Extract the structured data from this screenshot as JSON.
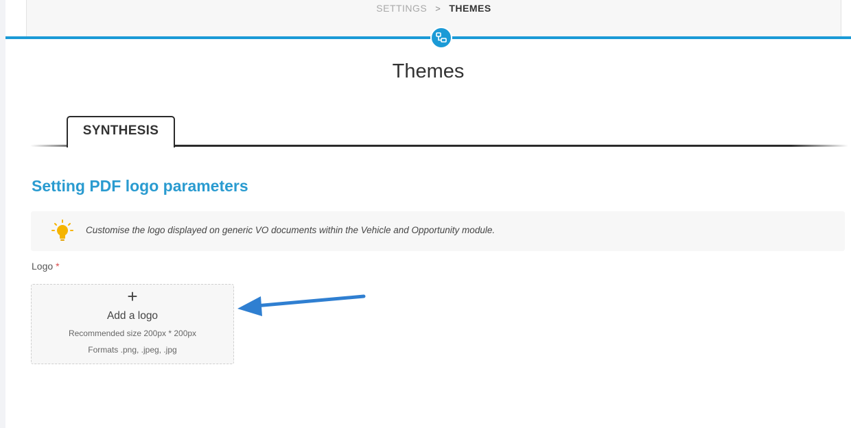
{
  "breadcrumb": {
    "parent": "SETTINGS",
    "separator": ">",
    "current": "THEMES"
  },
  "header": {
    "icon": "network-icon",
    "accent_color": "#1b9ad6"
  },
  "page": {
    "title": "Themes"
  },
  "tabs": [
    {
      "label": "SYNTHESIS",
      "active": true
    }
  ],
  "section": {
    "title": "Setting PDF logo parameters",
    "title_color": "#2a9bd0"
  },
  "info": {
    "icon": "lightbulb-icon",
    "text": "Customise the logo displayed on generic VO documents within the Vehicle and Opportunity module."
  },
  "logo_field": {
    "label": "Logo",
    "required_marker": "*",
    "plus": "+",
    "add_label": "Add a logo",
    "recommended": "Recommended size 200px * 200px",
    "formats": "Formats .png, .jpeg, .jpg"
  },
  "annotation": {
    "icon": "arrow-icon",
    "color": "#2f7fd1"
  }
}
